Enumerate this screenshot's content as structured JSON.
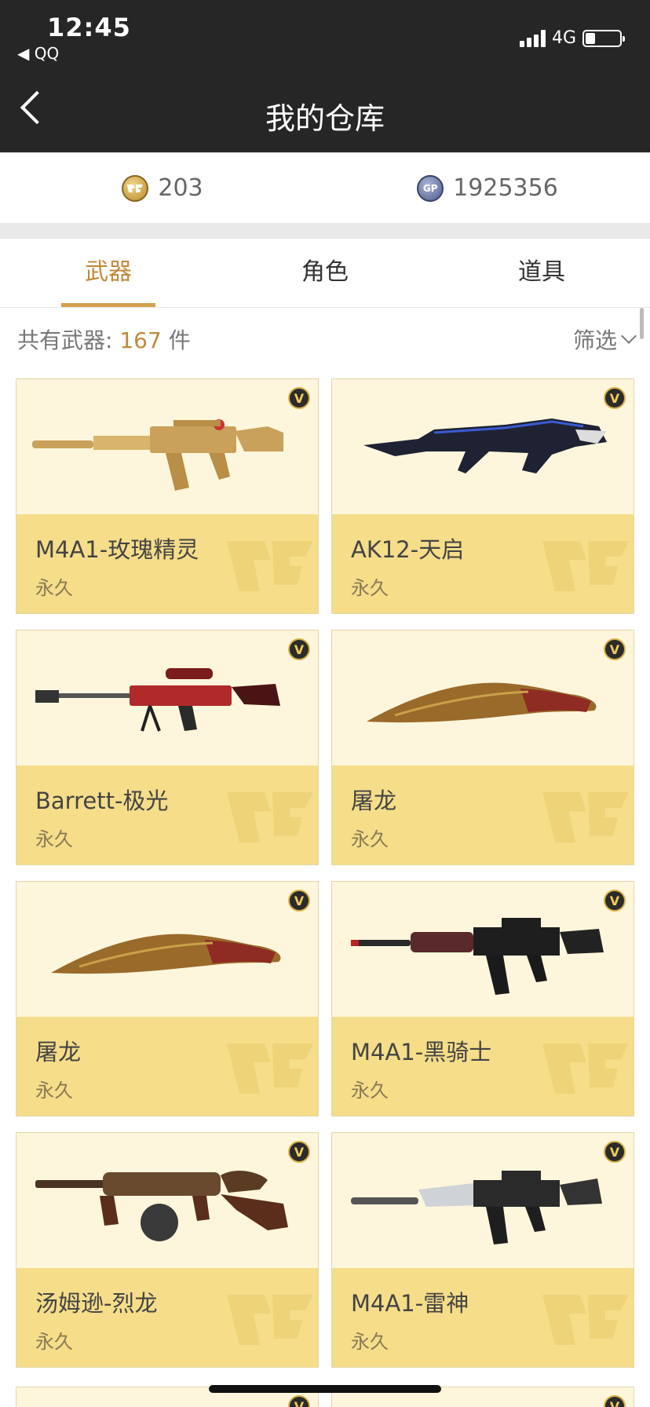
{
  "status": {
    "time": "12:45",
    "back_app": "◀ QQ",
    "network": "4G"
  },
  "nav": {
    "title": "我的仓库"
  },
  "currency": {
    "cf": {
      "icon": "cf-coin-icon",
      "value": "203"
    },
    "gp": {
      "icon": "gp-coin-icon",
      "value": "1925356",
      "badge": "GP"
    }
  },
  "tabs": [
    "武器",
    "角色",
    "道具"
  ],
  "summary": {
    "prefix": "共有武器: ",
    "count": "167",
    "unit": " 件",
    "filter_label": "筛选"
  },
  "items": [
    {
      "name": "M4A1-玫瑰精灵",
      "duration": "永久",
      "icon": "rifle-gold-icon"
    },
    {
      "name": "AK12-天启",
      "duration": "永久",
      "icon": "rifle-dark-icon"
    },
    {
      "name": "Barrett-极光",
      "duration": "永久",
      "icon": "sniper-red-icon"
    },
    {
      "name": "屠龙",
      "duration": "永久",
      "icon": "blade-icon"
    },
    {
      "name": "屠龙",
      "duration": "永久",
      "icon": "blade-icon"
    },
    {
      "name": "M4A1-黑骑士",
      "duration": "永久",
      "icon": "rifle-black-icon"
    },
    {
      "name": "汤姆逊-烈龙",
      "duration": "永久",
      "icon": "smg-dragon-icon"
    },
    {
      "name": "M4A1-雷神",
      "duration": "永久",
      "icon": "rifle-silver-icon"
    }
  ],
  "badge_letter": "V"
}
